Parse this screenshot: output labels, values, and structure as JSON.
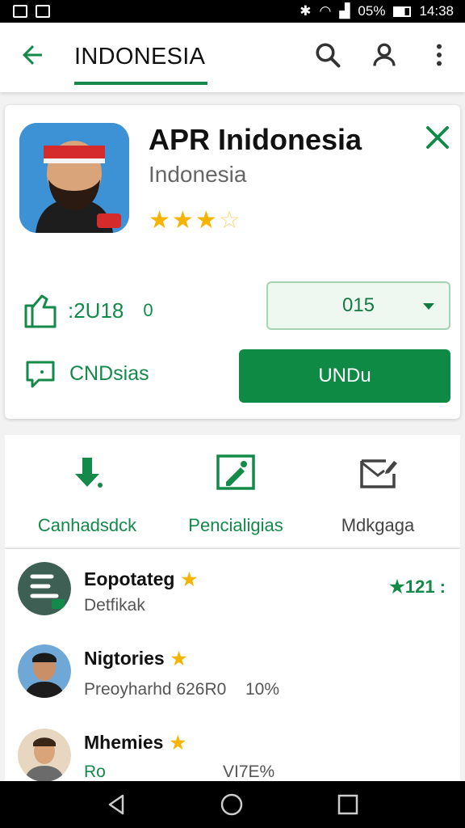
{
  "status_bar": {
    "time": "14:38",
    "battery": "05%"
  },
  "app_bar": {
    "title": "INDONESIA",
    "icons": [
      "back-arrow-icon",
      "search-icon",
      "account-icon",
      "more-vert-icon"
    ]
  },
  "app_card": {
    "name": "APR Inidonesia",
    "subtitle": "Indonesia",
    "rating_stars": 3,
    "rating_max": 5,
    "meta_value": ":2U18",
    "meta_extra": "0",
    "dropdown_value": "015",
    "secondary_label": "CNDsias",
    "primary_button": "UNDu"
  },
  "actions": [
    {
      "label": "Canhadsdck",
      "icon": "download-icon",
      "color": "#138a4a"
    },
    {
      "label": "Pencialigias",
      "icon": "image-edit-icon",
      "color": "#138a4a"
    },
    {
      "label": "Mdkgaga",
      "icon": "message-edit-icon",
      "color": "#444444"
    }
  ],
  "list": [
    {
      "title": "Eopotateg",
      "subtitle": "Detfikak",
      "right": "★121 :"
    },
    {
      "title": "Nigtories",
      "subtitle": "Preoyharhd 626R0",
      "subtitle2": "10%"
    },
    {
      "title": "Mhemies",
      "subtitle": "Ro",
      "subtitle2": "VI7E%"
    }
  ],
  "colors": {
    "accent": "#138a4a",
    "button": "#0f8a45",
    "star": "#f4b400"
  }
}
